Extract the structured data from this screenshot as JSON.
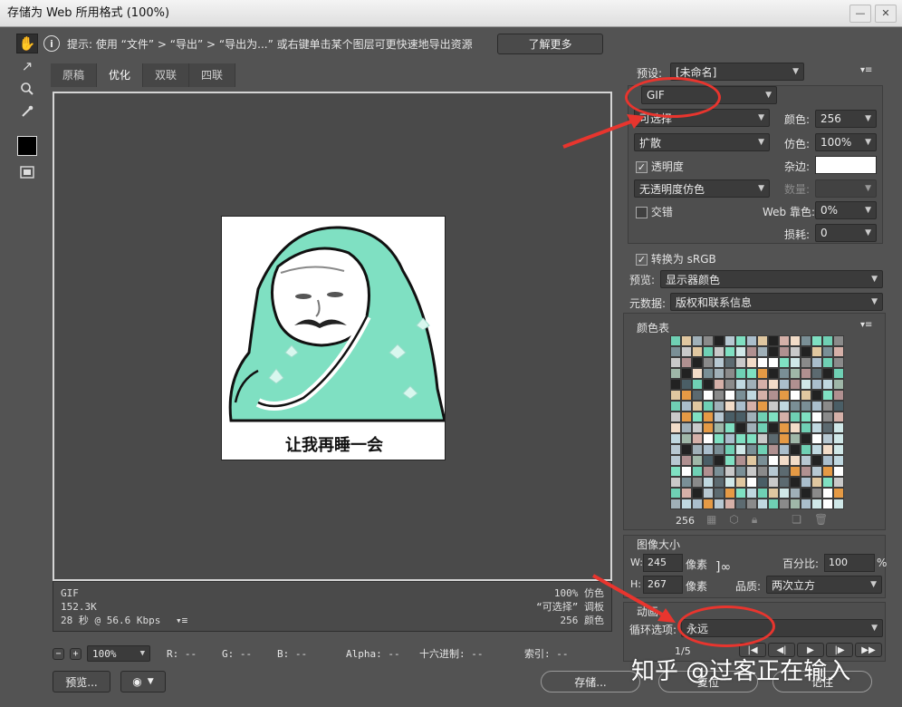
{
  "window": {
    "title": "存储为 Web 所用格式 (100%)",
    "minimize": "—",
    "close": "✕"
  },
  "colors": {
    "accent": "#e8352e",
    "panel": "#535353",
    "field": "#3b3b3b"
  },
  "hint": {
    "text": "提示: 使用 “文件” > “导出” > “导出为...” 或右键单击某个图层可更快速地导出资源",
    "learn_more": "了解更多"
  },
  "tabs": [
    {
      "label": "原稿"
    },
    {
      "label": "优化"
    },
    {
      "label": "双联"
    },
    {
      "label": "四联"
    }
  ],
  "image": {
    "caption": "让我再睡一会"
  },
  "meta": {
    "format": "GIF",
    "size": "152.3K",
    "time": "28 秒 @ 56.6 Kbps",
    "dither": "100% 仿色",
    "palette": "“可选择” 调板",
    "colors": "256 颜色"
  },
  "status": {
    "zoom": "100%",
    "r": "R: --",
    "g": "G: --",
    "b": "B: --",
    "alpha": "Alpha: --",
    "hex": "十六进制: --",
    "index": "索引: --"
  },
  "bottom": {
    "preview": "预览...",
    "save": "存储...",
    "reset": "复位",
    "remember": "记住"
  },
  "settings": {
    "preset_label": "预设:",
    "preset_value": "[未命名]",
    "format": "GIF",
    "reduction": "可选择",
    "dither_algo": "扩散",
    "colors_label": "颜色:",
    "colors_value": "256",
    "dither_label": "仿色:",
    "dither_value": "100%",
    "transparency_label": "透明度",
    "matte_label": "杂边:",
    "trans_dither": "无透明度仿色",
    "amount_label": "数量:",
    "interlaced_label": "交错",
    "websnap_label": "Web 靠色:",
    "websnap_value": "0%",
    "lossy_label": "损耗:",
    "lossy_value": "0",
    "srgb_label": "转换为 sRGB",
    "preview_label": "预览:",
    "preview_value": "显示器颜色",
    "metadata_label": "元数据:",
    "metadata_value": "版权和联系信息"
  },
  "color_table": {
    "title": "颜色表",
    "count": "256"
  },
  "image_size": {
    "title": "图像大小",
    "w_label": "W:",
    "w_value": "245",
    "h_label": "H:",
    "h_value": "267",
    "unit": "像素",
    "percent_label": "百分比:",
    "percent_value": "100",
    "percent_unit": "%",
    "quality_label": "品质:",
    "quality_value": "两次立方"
  },
  "animation": {
    "title": "动画",
    "loop_label": "循环选项:",
    "loop_value": "永远",
    "frame": "1/5"
  },
  "watermark": "知乎 @过客正在输入"
}
